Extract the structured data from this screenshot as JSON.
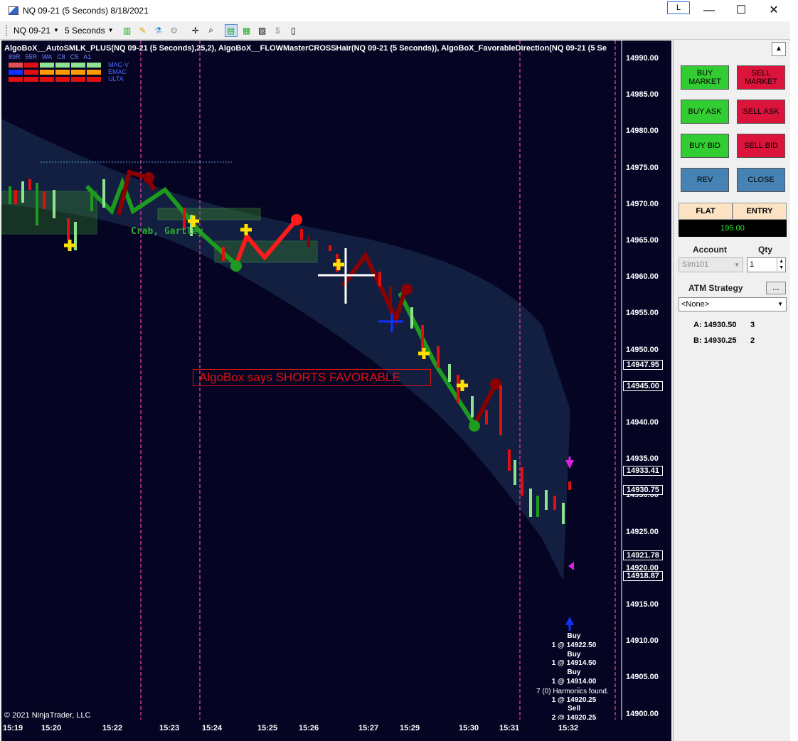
{
  "window": {
    "title": "NQ 09-21 (5 Seconds)  8/18/2021",
    "l_button": "L",
    "minimize": "—",
    "maximize": "☐",
    "close": "✕"
  },
  "toolbar": {
    "instrument": "NQ 09-21",
    "interval": "5 Seconds"
  },
  "chart": {
    "indicator_header": "AlgoBoX__AutoSMLK_PLUS(NQ 09-21 (5 Seconds),25,2), AlgoBoX__FLOWMasterCROSSHair(NQ 09-21 (5 Seconds)), AlgoBoX_FavorableDirection(NQ 09-21 (5 Se",
    "legend_cols": [
      "89R",
      "55R",
      "WA",
      "C8",
      "C5",
      "A1"
    ],
    "legend_rows": [
      "MAC-V",
      "EMAC",
      "ULTA"
    ],
    "banner": "AlgoBox says SHORTS FAVORABLE",
    "pattern_label": "Crab, Gartley",
    "harmonics": "7 (0) Harmonics found.",
    "copyright": "© 2021 NinjaTrader, LLC",
    "trades": [
      {
        "side": "Buy",
        "detail": "1 @ 14922.50"
      },
      {
        "side": "Buy",
        "detail": "1 @ 14914.50"
      },
      {
        "side": "Buy",
        "detail": "1 @ 14914.00"
      },
      {
        "side": "Sell",
        "detail": "1 @ 14920.25"
      },
      {
        "side": "Sell",
        "detail": "2 @ 14920.25"
      }
    ],
    "y_ticks": [
      "14990.00",
      "14985.00",
      "14980.00",
      "14975.00",
      "14970.00",
      "14965.00",
      "14960.00",
      "14955.00",
      "14950.00",
      "14945.00",
      "14940.00",
      "14935.00",
      "14930.00",
      "14925.00",
      "14920.00",
      "14915.00",
      "14910.00",
      "14905.00",
      "14900.00"
    ],
    "price_markers": [
      "14947.95",
      "14945.00",
      "14933.41",
      "14930.75",
      "14921.78",
      "14918.87"
    ],
    "x_ticks": [
      "15:19",
      "15:20",
      "15:22",
      "15:23",
      "15:24",
      "15:25",
      "15:26",
      "15:27",
      "15:29",
      "15:30",
      "15:31",
      "15:32"
    ]
  },
  "panel": {
    "buy_market": "BUY MARKET",
    "sell_market": "SELL MARKET",
    "buy_ask": "BUY ASK",
    "sell_ask": "SELL ASK",
    "buy_bid": "BUY BID",
    "sell_bid": "SELL BID",
    "rev": "REV",
    "close": "CLOSE",
    "flat": "FLAT",
    "entry": "ENTRY",
    "pnl": "195.00",
    "account_label": "Account",
    "qty_label": "Qty",
    "account_value": "Sim101",
    "qty_value": "1",
    "atm_label": "ATM Strategy",
    "atm_button": "...",
    "atm_value": "<None>",
    "ask_label": "A: 14930.50",
    "ask_size": "3",
    "bid_label": "B: 14930.25",
    "bid_size": "2"
  }
}
